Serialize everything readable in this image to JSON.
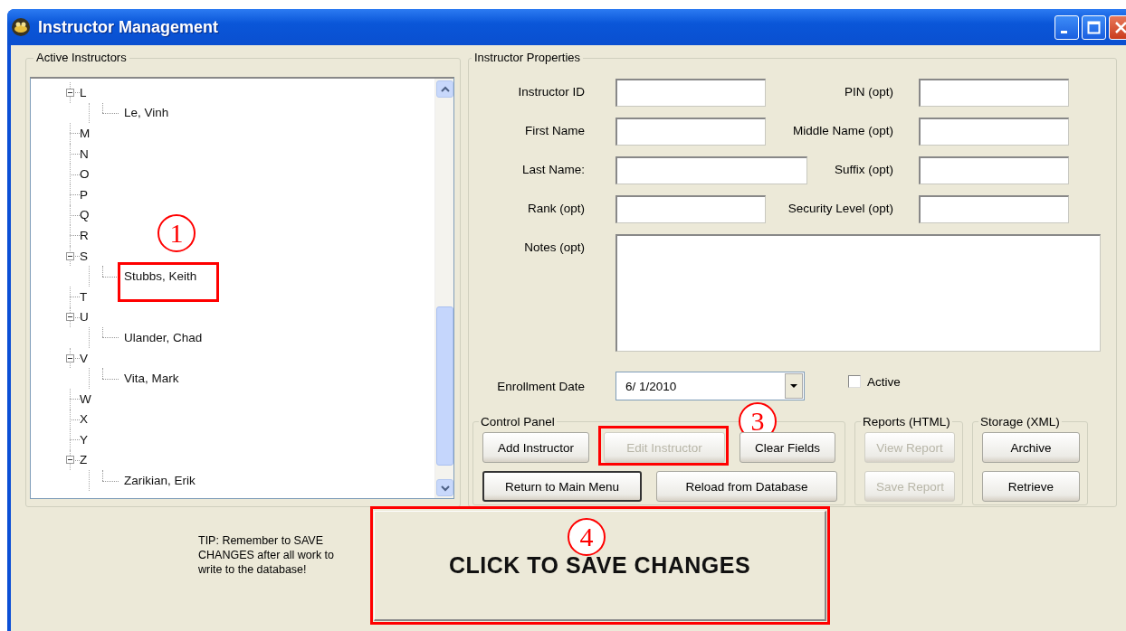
{
  "window": {
    "title": "Instructor Management"
  },
  "active_instructors": {
    "title": "Active Instructors",
    "tree": [
      {
        "label": "L",
        "expanded": true,
        "children": [
          {
            "label": "Le, Vinh"
          }
        ]
      },
      {
        "label": "M"
      },
      {
        "label": "N"
      },
      {
        "label": "O"
      },
      {
        "label": "P"
      },
      {
        "label": "Q"
      },
      {
        "label": "R"
      },
      {
        "label": "S",
        "expanded": true,
        "children": [
          {
            "label": "Stubbs, Keith",
            "annotation": "1"
          }
        ]
      },
      {
        "label": "T"
      },
      {
        "label": "U",
        "expanded": true,
        "children": [
          {
            "label": "Ulander, Chad"
          }
        ]
      },
      {
        "label": "V",
        "expanded": true,
        "children": [
          {
            "label": "Vita, Mark"
          }
        ]
      },
      {
        "label": "W"
      },
      {
        "label": "X"
      },
      {
        "label": "Y"
      },
      {
        "label": "Z",
        "expanded": true,
        "children": [
          {
            "label": "Zarikian, Erik"
          }
        ]
      }
    ]
  },
  "instructor_properties": {
    "title": "Instructor Properties",
    "field_rows": [
      [
        {
          "label": "Instructor ID",
          "kind": "short"
        },
        {
          "label": "PIN (opt)",
          "kind": "short"
        }
      ],
      [
        {
          "label": "First Name",
          "kind": "short"
        },
        {
          "label": "Middle Name (opt)",
          "kind": "short"
        }
      ],
      [
        {
          "label": "Last Name:",
          "kind": "wide"
        },
        {
          "label": "Suffix (opt)",
          "kind": "short"
        }
      ],
      [
        {
          "label": "Rank (opt)",
          "kind": "short"
        },
        {
          "label": "Security Level (opt)",
          "kind": "short"
        }
      ],
      [
        {
          "label": "Notes (opt)",
          "kind": "multiline"
        }
      ]
    ],
    "enrollment_date": {
      "label": "Enrollment Date",
      "value": "6/ 1/2010"
    },
    "active": {
      "label": "Active",
      "checked": false
    },
    "groups": [
      {
        "title": "Control Panel",
        "rows": [
          [
            {
              "label": "Add Instructor",
              "disabled": false,
              "default": false
            },
            {
              "label": "Edit Instructor",
              "disabled": true,
              "default": false,
              "annotation": "3"
            },
            {
              "label": "Clear Fields",
              "disabled": false,
              "default": false
            }
          ],
          [
            {
              "label": "Return to Main Menu",
              "disabled": false,
              "default": true
            },
            {
              "label": "Reload from Database",
              "disabled": false,
              "default": false
            }
          ]
        ]
      },
      {
        "title": "Reports (HTML)",
        "rows": [
          [
            {
              "label": "View Report",
              "disabled": true,
              "default": false
            }
          ],
          [
            {
              "label": "Save Report",
              "disabled": true,
              "default": false
            }
          ]
        ]
      },
      {
        "title": "Storage (XML)",
        "rows": [
          [
            {
              "label": "Archive",
              "disabled": false,
              "default": false
            }
          ],
          [
            {
              "label": "Retrieve",
              "disabled": false,
              "default": false
            }
          ]
        ]
      }
    ]
  },
  "tip": "TIP: Remember to SAVE CHANGES after all work to write to the database!",
  "save_button": {
    "label": "CLICK TO SAVE CHANGES",
    "annotation": "4"
  }
}
